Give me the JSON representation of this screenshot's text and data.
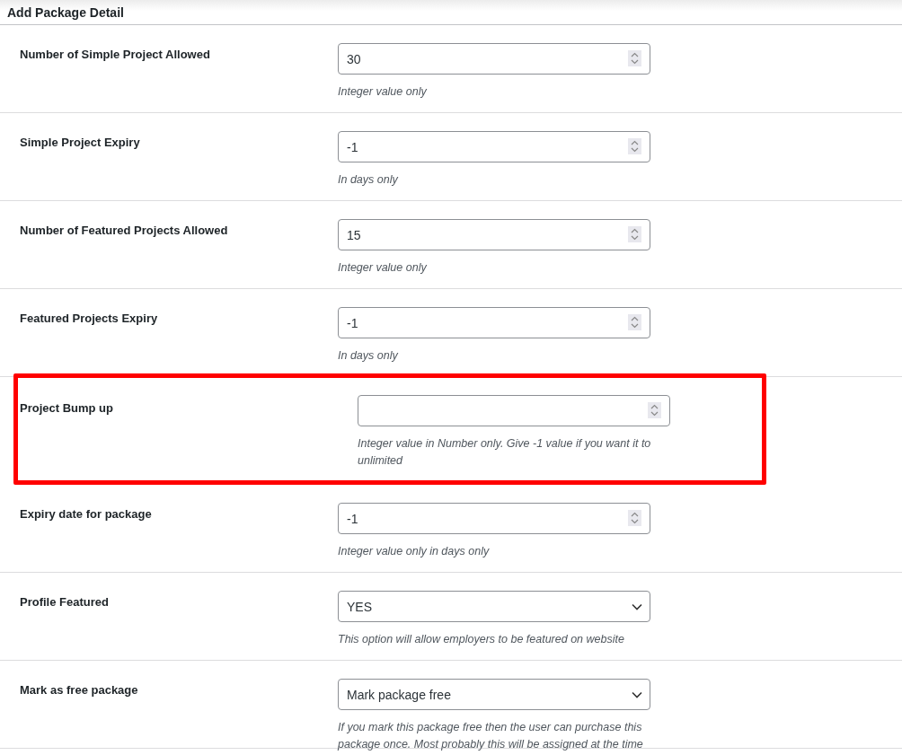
{
  "panel": {
    "title": "Add Package Detail"
  },
  "rows": [
    {
      "label": "Number of Simple Project Allowed",
      "kind": "number",
      "value": "30",
      "description": "Integer value only",
      "highlighted": false
    },
    {
      "label": "Simple Project Expiry",
      "kind": "number",
      "value": "-1",
      "description": "In days only",
      "highlighted": false
    },
    {
      "label": "Number of Featured Projects Allowed",
      "kind": "number",
      "value": "15",
      "description": "Integer value only",
      "highlighted": false
    },
    {
      "label": "Featured Projects Expiry",
      "kind": "number",
      "value": "-1",
      "description": "In days only",
      "highlighted": false
    },
    {
      "label": "Project Bump up",
      "kind": "number",
      "value": "",
      "description": "Integer value in Number only. Give -1 value if you want it to unlimited",
      "highlighted": true
    },
    {
      "label": "Expiry date for package",
      "kind": "number",
      "value": "-1",
      "description": "Integer value only in days only",
      "highlighted": false
    },
    {
      "label": "Profile Featured",
      "kind": "select",
      "value": "YES",
      "description": "This option will allow employers to be featured on website",
      "highlighted": false
    },
    {
      "label": "Mark as free package",
      "kind": "select",
      "value": "Mark package free",
      "description": "If you mark this package free then the user can purchase this package once. Most probably this will be assigned at the time",
      "highlighted": false
    }
  ]
}
